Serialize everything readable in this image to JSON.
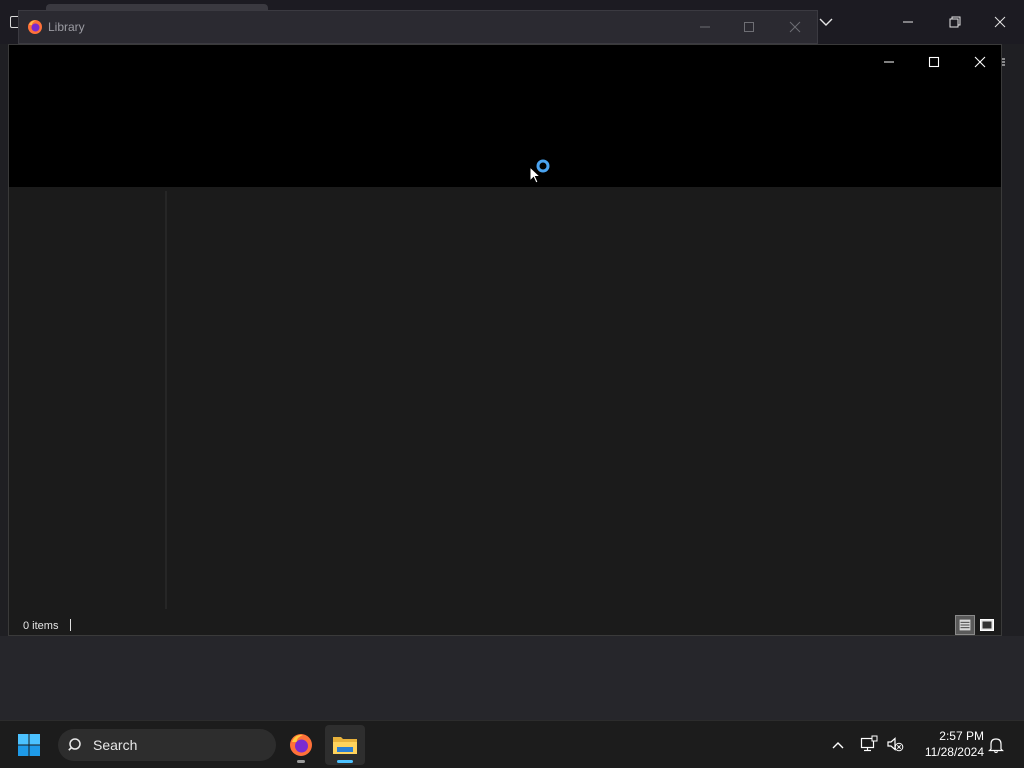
{
  "library_window": {
    "title": "Library",
    "status_text": "0 items"
  },
  "taskbar": {
    "search_placeholder": "Search",
    "time": "2:57 PM",
    "date": "11/28/2024"
  },
  "colors": {
    "accent": "#4aa3f0",
    "taskbar_bg": "#1c1c1c",
    "toolbar_bg": "#000000",
    "content_bg": "#1b1b1b"
  },
  "icons": {
    "library_title": "firefox-icon",
    "start": "windows-logo-icon",
    "search": "search-icon",
    "firefox_app": "firefox-icon",
    "explorer_app": "folder-icon",
    "tray_chevron": "chevron-up-icon",
    "tray_network": "network-icon",
    "tray_volume": "volume-muted-icon",
    "notifications": "bell-icon",
    "loading": "spinner-icon",
    "cursor": "mouse-pointer-icon"
  }
}
